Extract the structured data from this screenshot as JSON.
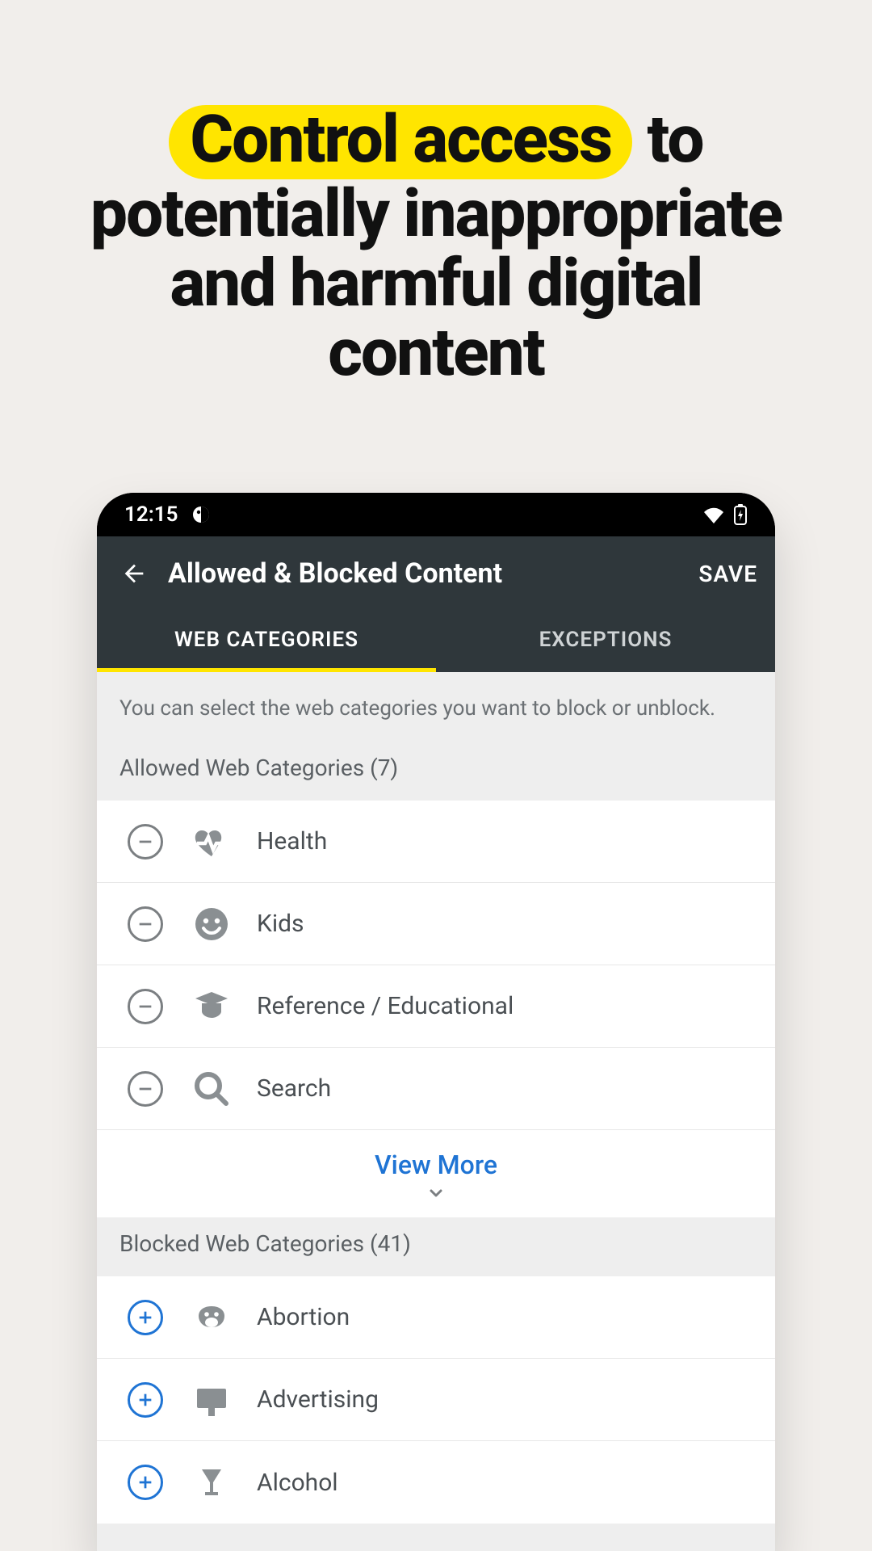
{
  "headline": {
    "highlight": "Control access",
    "rest1": "  to",
    "line2": "potentially inappropriate",
    "line3": "and harmful digital content"
  },
  "statusbar": {
    "time": "12:15"
  },
  "appbar": {
    "title": "Allowed & Blocked Content",
    "save": "SAVE"
  },
  "tabs": {
    "web": "WEB CATEGORIES",
    "exceptions": "EXCEPTIONS"
  },
  "intro": "You can select the web categories you want to block or unblock.",
  "allowed": {
    "header": "Allowed Web Categories (7)",
    "items": [
      {
        "label": "Health"
      },
      {
        "label": "Kids"
      },
      {
        "label": "Reference / Educational"
      },
      {
        "label": "Search"
      }
    ],
    "view_more": "View More"
  },
  "blocked": {
    "header": "Blocked Web Categories (41)",
    "items": [
      {
        "label": "Abortion"
      },
      {
        "label": "Advertising"
      },
      {
        "label": "Alcohol"
      }
    ]
  }
}
